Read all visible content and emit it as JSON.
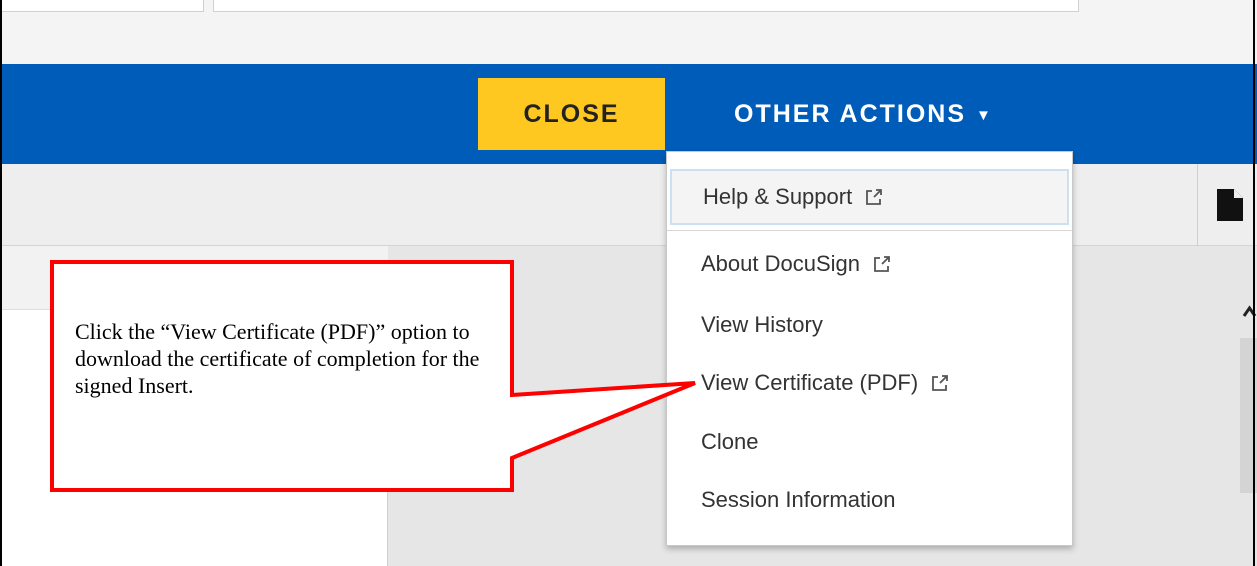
{
  "header": {
    "close_label": "CLOSE",
    "other_actions_label": "OTHER ACTIONS",
    "caret_glyph": "▼"
  },
  "menu": {
    "items": [
      {
        "label": "Help & Support",
        "icon": "external-link-icon"
      },
      {
        "label": "About DocuSign",
        "icon": "external-link-icon"
      },
      {
        "label": "View History",
        "icon": null
      },
      {
        "label": "View Certificate (PDF)",
        "icon": "external-link-icon"
      },
      {
        "label": "Clone",
        "icon": null
      },
      {
        "label": "Session Information",
        "icon": null
      }
    ]
  },
  "callout": {
    "text": "Click the “View Certificate (PDF)” option to download the certificate of completion for the signed Insert."
  },
  "colors": {
    "header_blue": "#005cb9",
    "close_yellow": "#ffc820",
    "callout_red": "#ff0000"
  }
}
